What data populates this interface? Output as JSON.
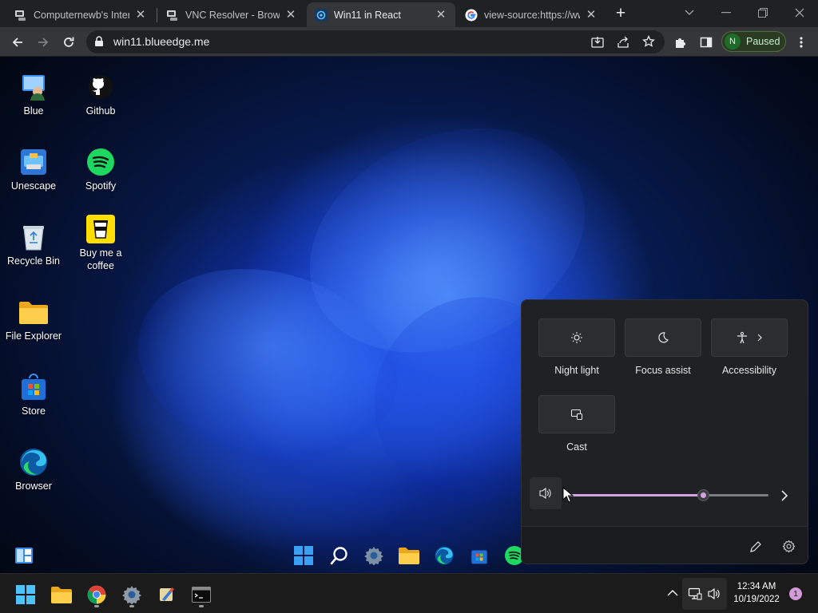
{
  "browser": {
    "tabs": [
      {
        "title": "Computernewb's Intern",
        "active": false
      },
      {
        "title": "VNC Resolver - Browse",
        "active": false
      },
      {
        "title": "Win11 in React",
        "active": true
      },
      {
        "title": "view-source:https://ww",
        "active": false
      }
    ],
    "url": "win11.blueedge.me",
    "profile": {
      "initial": "N",
      "status": "Paused"
    }
  },
  "desktop": {
    "icons": [
      {
        "label": "Blue"
      },
      {
        "label": "Github"
      },
      {
        "label": "Unescape"
      },
      {
        "label": "Spotify"
      },
      {
        "label": "Recycle Bin"
      },
      {
        "label": "Buy me a coffee"
      },
      {
        "label": "File Explorer"
      },
      {
        "label": "Store"
      },
      {
        "label": "Browser"
      }
    ]
  },
  "quick_settings": {
    "tiles": [
      {
        "label": "Night light",
        "icon": "brightness-icon"
      },
      {
        "label": "Focus assist",
        "icon": "moon-icon"
      },
      {
        "label": "Accessibility",
        "icon": "accessibility-icon"
      },
      {
        "label": "Cast",
        "icon": "cast-icon"
      }
    ],
    "volume_level": 0.68
  },
  "taskbar": {
    "time": "12:34 AM",
    "date": "10/19/2022",
    "notification_count": "1"
  },
  "colors": {
    "accent_volume": "#d7a2e3",
    "chrome_dark": "#202124",
    "chrome_toolbar": "#35363a"
  }
}
